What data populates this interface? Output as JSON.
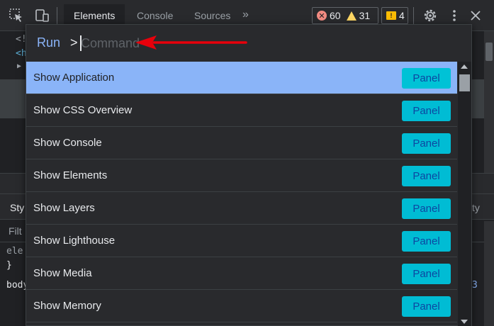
{
  "toolbar": {
    "tabs": [
      {
        "label": "Elements",
        "active": true
      },
      {
        "label": "Console",
        "active": false
      },
      {
        "label": "Sources",
        "active": false
      }
    ],
    "more_tabs": "»",
    "errors": "60",
    "warnings": "31",
    "issues": "4"
  },
  "background": {
    "code_lines": [
      "<!",
      "<h",
      "▶"
    ],
    "styles_tab": "Sty",
    "computed_tail": "ty",
    "filter_text": "Filt",
    "element_text": "ele",
    "brace": "}",
    "body_text": "body",
    "right_num": "3"
  },
  "palette": {
    "prompt_label": "Run",
    "prompt_caret": ">",
    "placeholder": "Command",
    "items": [
      {
        "label": "Show Application",
        "button": "Panel",
        "selected": true
      },
      {
        "label": "Show CSS Overview",
        "button": "Panel",
        "selected": false
      },
      {
        "label": "Show Console",
        "button": "Panel",
        "selected": false
      },
      {
        "label": "Show Elements",
        "button": "Panel",
        "selected": false
      },
      {
        "label": "Show Layers",
        "button": "Panel",
        "selected": false
      },
      {
        "label": "Show Lighthouse",
        "button": "Panel",
        "selected": false
      },
      {
        "label": "Show Media",
        "button": "Panel",
        "selected": false
      },
      {
        "label": "Show Memory",
        "button": "Panel",
        "selected": false
      }
    ]
  },
  "colors": {
    "accent": "#8ab4f8",
    "panel_button": "#00bcd4",
    "arrow": "#e8000b"
  }
}
